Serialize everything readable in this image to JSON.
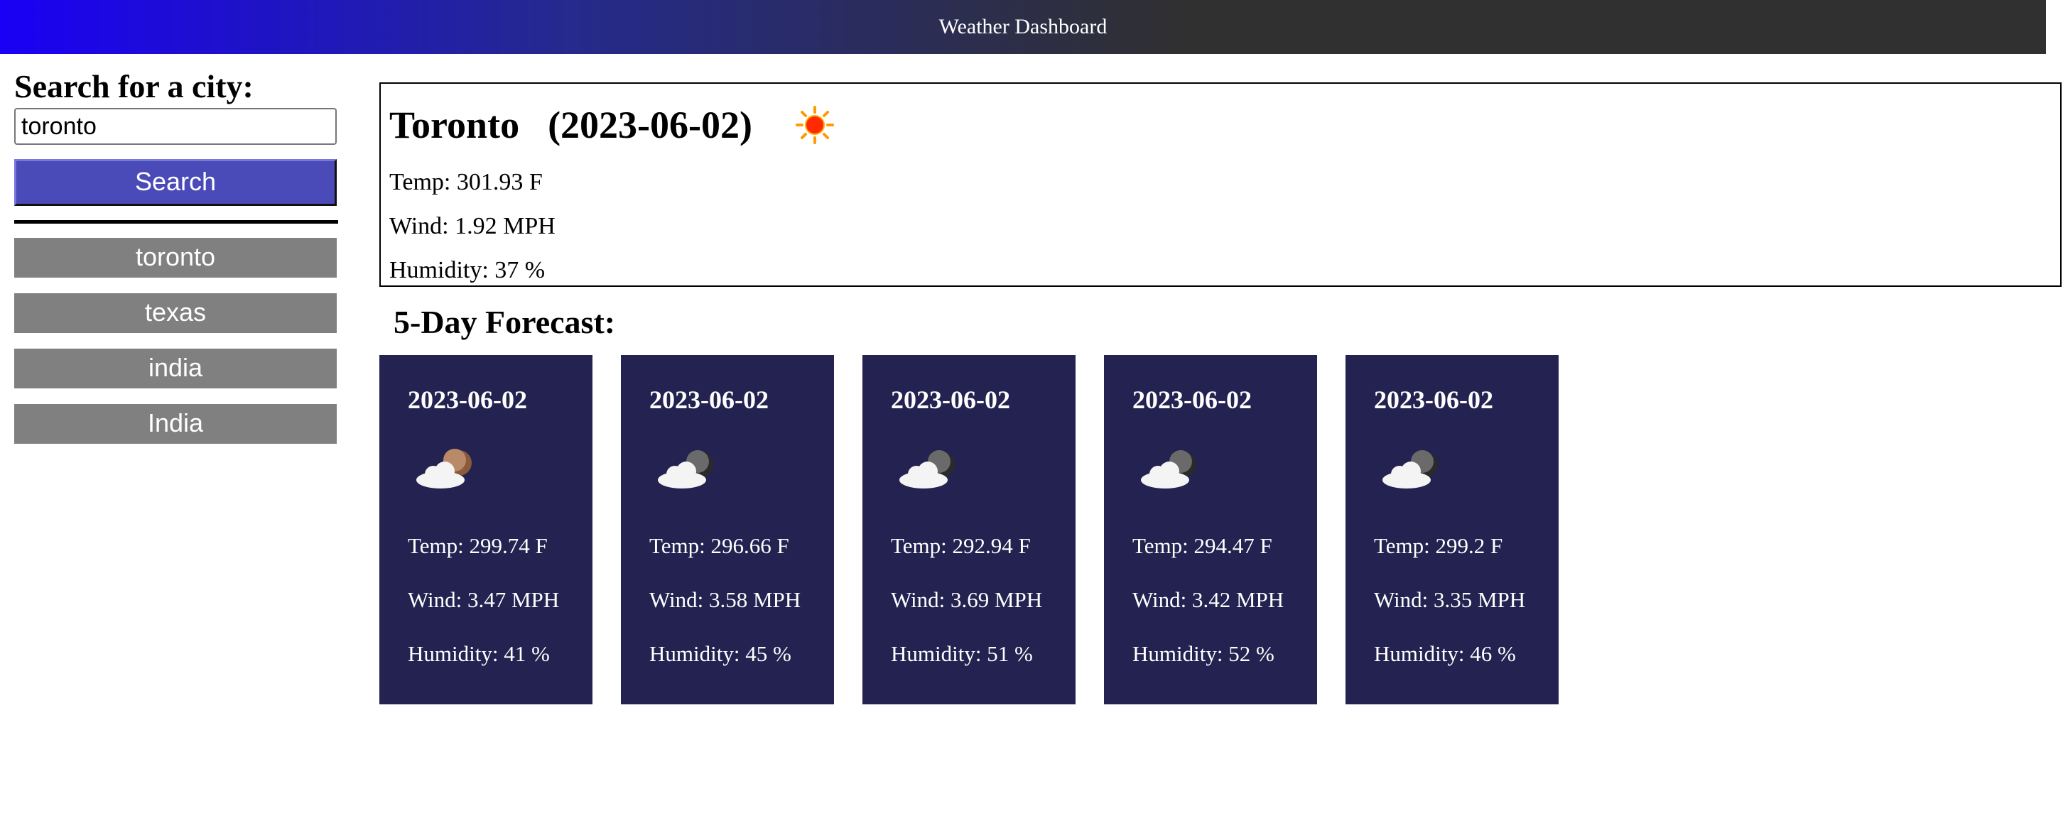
{
  "header": {
    "title": "Weather Dashboard"
  },
  "search": {
    "heading": "Search for a city:",
    "input_value": "toronto",
    "button_label": "Search"
  },
  "history": [
    "toronto",
    "texas",
    "india",
    "India"
  ],
  "current": {
    "city": "Toronto",
    "date": "(2023-06-02)",
    "icon": "sun-icon",
    "temp": "Temp: 301.93 F",
    "wind": "Wind: 1.92 MPH",
    "humidity": "Humidity: 37 %"
  },
  "forecast": {
    "heading": "5-Day Forecast:",
    "days": [
      {
        "date": "2023-06-02",
        "icon": "cloud-moon-icon",
        "temp": "Temp: 299.74 F",
        "wind": "Wind: 3.47 MPH",
        "humidity": "Humidity: 41 %"
      },
      {
        "date": "2023-06-02",
        "icon": "cloud-dark-moon-icon",
        "temp": "Temp: 296.66 F",
        "wind": "Wind: 3.58 MPH",
        "humidity": "Humidity: 45 %"
      },
      {
        "date": "2023-06-02",
        "icon": "cloud-dark-moon-icon",
        "temp": "Temp: 292.94 F",
        "wind": "Wind: 3.69 MPH",
        "humidity": "Humidity: 51 %"
      },
      {
        "date": "2023-06-02",
        "icon": "cloud-dark-moon-icon",
        "temp": "Temp: 294.47 F",
        "wind": "Wind: 3.42 MPH",
        "humidity": "Humidity: 52 %"
      },
      {
        "date": "2023-06-02",
        "icon": "cloud-dark-moon-icon",
        "temp": "Temp: 299.2 F",
        "wind": "Wind: 3.35 MPH",
        "humidity": "Humidity: 46 %"
      }
    ]
  },
  "colors": {
    "header_gradient_start": "#1a00f5",
    "header_end": "#303030",
    "search_button": "#4a4ab8",
    "history_button": "#808080",
    "forecast_card": "#232250"
  }
}
